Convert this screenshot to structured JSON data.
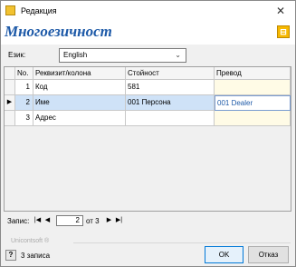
{
  "window": {
    "title": "Редакция",
    "close_glyph": "✕"
  },
  "header": {
    "title": "Многоезичност",
    "corner_glyph": "⊟"
  },
  "language": {
    "label": "Език:",
    "value": "English"
  },
  "grid": {
    "columns": [
      "No.",
      "Реквизит/колона",
      "Стойност",
      "Превод"
    ],
    "rows": [
      {
        "no": "1",
        "field": "Код",
        "value": "581",
        "translation": ""
      },
      {
        "no": "2",
        "field": "Име",
        "value": "001 Персона",
        "translation": "001 Dealer"
      },
      {
        "no": "3",
        "field": "Адрес",
        "value": "",
        "translation": ""
      }
    ],
    "current_row_marker": "▶"
  },
  "navigator": {
    "label": "Запис:",
    "first": "|◀",
    "prev": "◀",
    "current": "2",
    "of_text": "от 3",
    "next": "▶",
    "last": "▶|"
  },
  "footer": {
    "brand": "Unicontsoft ®",
    "help_glyph": "?",
    "status": "3 записа",
    "ok": "OK",
    "cancel": "Отказ"
  }
}
